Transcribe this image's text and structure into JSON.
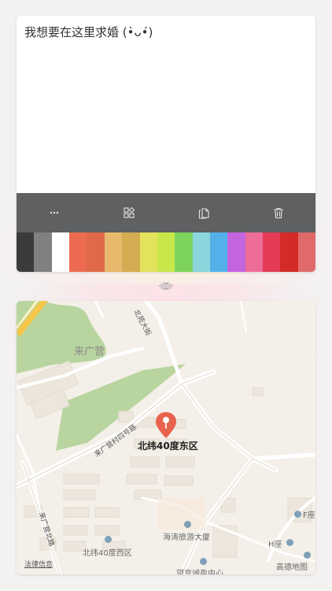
{
  "note": {
    "text": "我想要在这里求婚 (•̀ᴗ•́)"
  },
  "toolbar": {
    "items": [
      {
        "name": "more-icon"
      },
      {
        "name": "apps-add-icon"
      },
      {
        "name": "copy-icon"
      },
      {
        "name": "trash-icon"
      }
    ]
  },
  "palette": {
    "colors": [
      "#3b3b3b",
      "#808080",
      "#ffffff",
      "#ec6b50",
      "#e0694a",
      "#e8b86c",
      "#d4ac52",
      "#e2e25c",
      "#c8e84a",
      "#7ed35e",
      "#8ad6dc",
      "#53b0e8",
      "#c464de",
      "#ee6c98",
      "#e33a56",
      "#d32b27",
      "#e06a6a"
    ]
  },
  "map": {
    "labels": {
      "area_laiguangying": "来广营",
      "road_beiyuan": "北苑大街",
      "road_laiguangying_xi": "来广营村四号路",
      "road_laiguangying_bei": "来广营北路",
      "marker_title": "北纬40度东区",
      "west_district": "北纬40度西区",
      "haitao": "海涛旅游大厦",
      "wangjing": "望京诚盈中心",
      "f_block": "F座",
      "h_block": "H座",
      "legal": "法律信息",
      "provider": "高德地图"
    }
  }
}
